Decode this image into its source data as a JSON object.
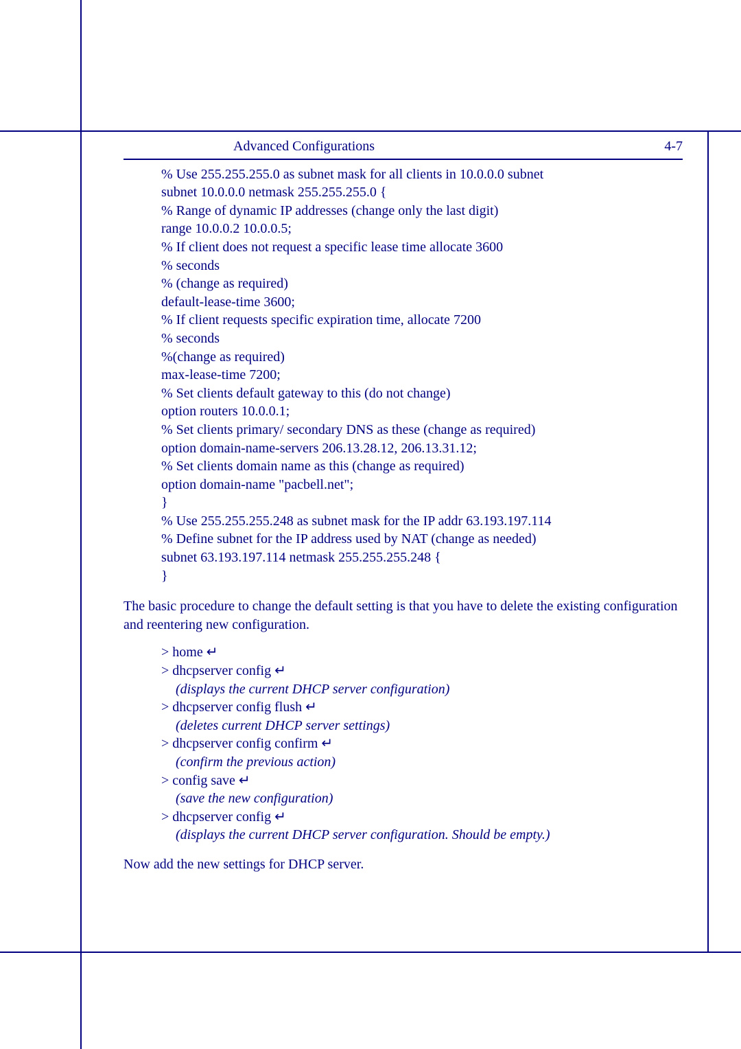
{
  "header": {
    "title": "Advanced Configurations",
    "pageNum": "4-7"
  },
  "configLines": [
    "% Use 255.255.255.0 as subnet mask for all clients in 10.0.0.0 subnet",
    "subnet 10.0.0.0 netmask 255.255.255.0 {",
    "% Range of dynamic IP addresses (change only the last digit)",
    "range 10.0.0.2 10.0.0.5;",
    "% If client does not request a specific lease time allocate 3600",
    "% seconds",
    "% (change as required)",
    "default-lease-time 3600;",
    "% If client requests specific expiration time, allocate 7200",
    "% seconds",
    "%(change as required)",
    "max-lease-time 7200;",
    "% Set clients default gateway to this (do not change)",
    "option routers 10.0.0.1;",
    "% Set clients primary/ secondary DNS as these (change as required)",
    "option domain-name-servers 206.13.28.12, 206.13.31.12;",
    "% Set clients domain name as this (change as required)",
    "option domain-name \"pacbell.net\";",
    "}",
    "% Use 255.255.255.248 as subnet mask for the IP addr 63.193.197.114",
    "% Define subnet for the IP address used by NAT (change as needed)",
    "subnet 63.193.197.114 netmask 255.255.255.248 {",
    "}"
  ],
  "midPara": "The basic procedure to change the default setting is that you have to delete the existing configuration and reentering new configuration.",
  "cmdLines": [
    {
      "t": "cmd",
      "text": "> home ↵"
    },
    {
      "t": "cmd",
      "text": "> dhcpserver config ↵"
    },
    {
      "t": "note",
      "text": "(displays the current DHCP server configuration)"
    },
    {
      "t": "cmd",
      "text": "> dhcpserver config flush ↵"
    },
    {
      "t": "note",
      "text": "(deletes current DHCP server settings)"
    },
    {
      "t": "cmd",
      "text": "> dhcpserver config confirm ↵"
    },
    {
      "t": "note",
      "text": "(confirm the previous action)"
    },
    {
      "t": "cmd",
      "text": "> config save ↵"
    },
    {
      "t": "note",
      "text": "(save the new configuration)"
    },
    {
      "t": "cmd",
      "text": "> dhcpserver config ↵"
    },
    {
      "t": "note",
      "text": "(displays the current DHCP server configuration. Should be empty.)"
    }
  ],
  "closingPara": "Now add the new settings for DHCP server."
}
